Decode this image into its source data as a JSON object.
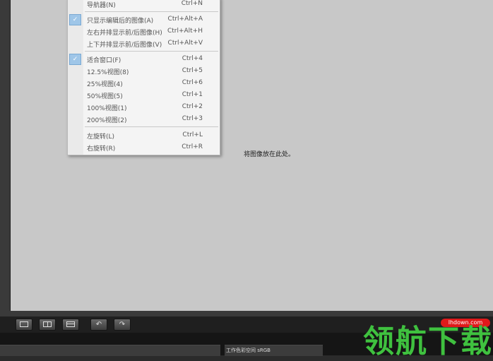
{
  "canvas": {
    "drop_hint": "将图像放在此处。"
  },
  "menu": {
    "items": [
      {
        "label": "导航器(N)",
        "shortcut": "Ctrl+N",
        "checked": false
      },
      {
        "label": "只显示编辑后的图像(A)",
        "shortcut": "Ctrl+Alt+A",
        "checked": true
      },
      {
        "label": "左右并排显示前/后图像(H)",
        "shortcut": "Ctrl+Alt+H",
        "checked": false
      },
      {
        "label": "上下并排显示前/后图像(V)",
        "shortcut": "Ctrl+Alt+V",
        "checked": false
      },
      {
        "label": "适合窗口(F)",
        "shortcut": "Ctrl+4",
        "checked": true
      },
      {
        "label": "12.5%视图(8)",
        "shortcut": "Ctrl+5",
        "checked": false
      },
      {
        "label": "25%视图(4)",
        "shortcut": "Ctrl+6",
        "checked": false
      },
      {
        "label": "50%视图(5)",
        "shortcut": "Ctrl+1",
        "checked": false
      },
      {
        "label": "100%视图(1)",
        "shortcut": "Ctrl+2",
        "checked": false
      },
      {
        "label": "200%视图(2)",
        "shortcut": "Ctrl+3",
        "checked": false
      },
      {
        "label": "左旋转(L)",
        "shortcut": "Ctrl+L",
        "checked": false
      },
      {
        "label": "右旋转(R)",
        "shortcut": "Ctrl+R",
        "checked": false
      }
    ],
    "check_glyph": "✓"
  },
  "toolbar": {
    "buttons": [
      {
        "icon": "single-view-icon"
      },
      {
        "icon": "side-by-side-view-icon"
      },
      {
        "icon": "top-bottom-view-icon"
      },
      {
        "icon": "rotate-left-icon",
        "glyph": "↶"
      },
      {
        "icon": "rotate-right-icon",
        "glyph": "↷"
      }
    ]
  },
  "status": {
    "color_space": "工作色彩空间 sRGB"
  },
  "watermark": {
    "brand": "领航下载",
    "site": "lhdown.com"
  },
  "colors": {
    "canvas": "#c8c8c8",
    "menu_bg": "#f4f4f4",
    "check_bg": "#9fc6e8",
    "watermark_green": "#3fc13f",
    "watermark_red": "#e0191b"
  }
}
